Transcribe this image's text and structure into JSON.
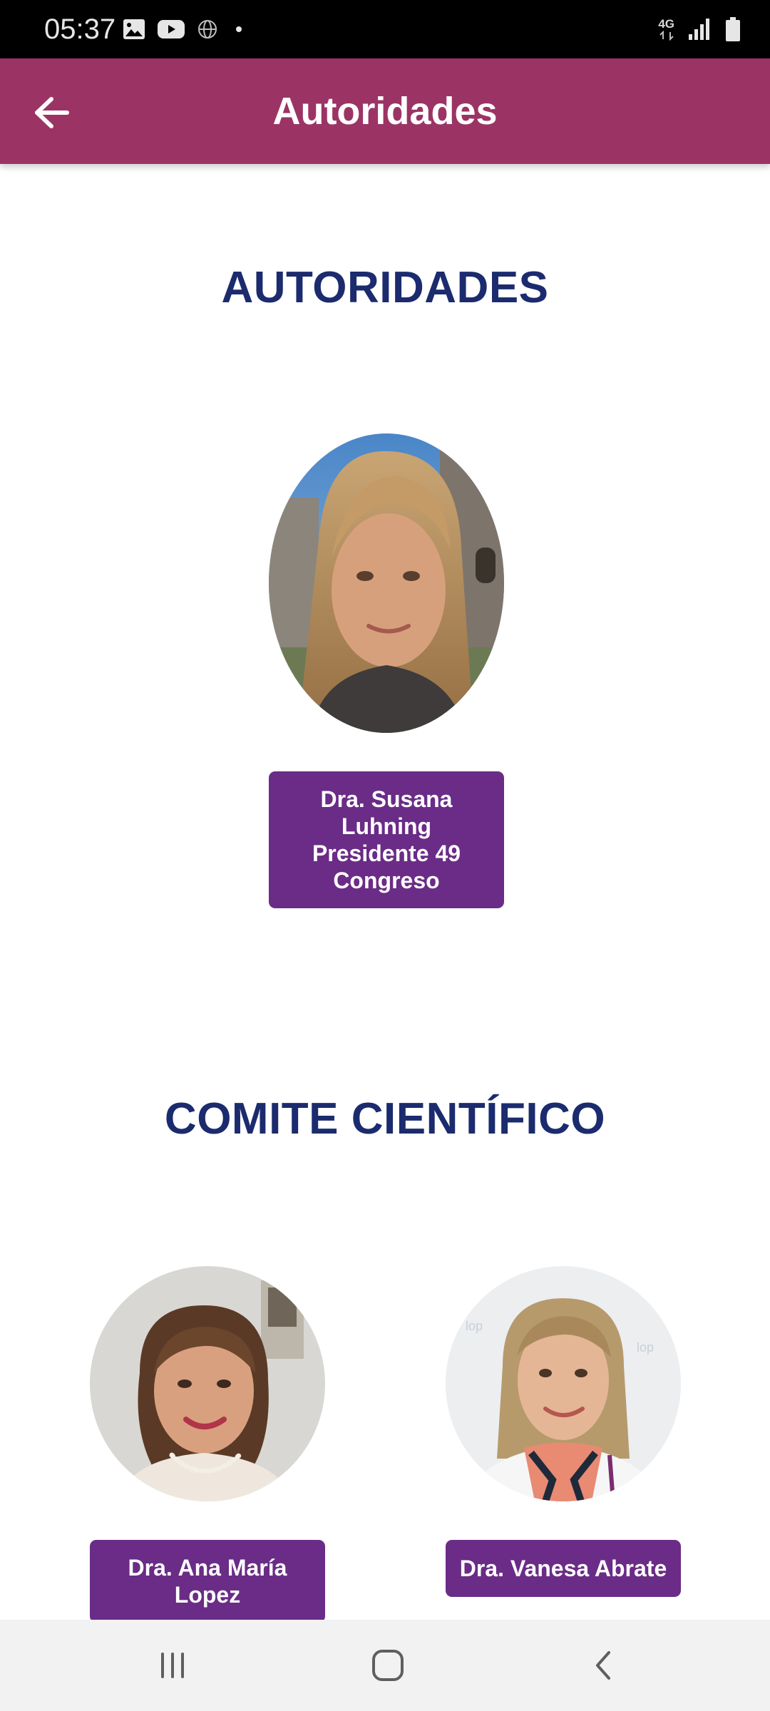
{
  "status_bar": {
    "time": "05:37",
    "left_icons": [
      "image-icon",
      "youtube-icon",
      "globe-icon",
      "dot-icon"
    ],
    "network_label": "4G",
    "right_icons": [
      "signal-icon",
      "battery-icon"
    ]
  },
  "app_bar": {
    "title": "Autoridades",
    "back_icon": "arrow-left-icon"
  },
  "sections": {
    "authorities": {
      "heading": "AUTORIDADES",
      "people": [
        {
          "name_lines": [
            "Dra. Susana",
            "Luhning",
            "Presidente 49",
            "Congreso"
          ]
        }
      ]
    },
    "scientific_committee": {
      "heading": "COMITE CIENTÍFICO",
      "people": [
        {
          "name_lines": [
            "Dra. Ana María",
            "Lopez"
          ]
        },
        {
          "name_lines": [
            "Dra. Vanesa Abrate"
          ]
        }
      ]
    }
  },
  "nav_bar": {
    "icons": [
      "recent-apps-icon",
      "home-icon",
      "back-icon"
    ]
  },
  "colors": {
    "app_bar": "#9b3465",
    "heading": "#1b2b6e",
    "name_card": "#6a2c86",
    "nav_bar": "#f2f2f2"
  }
}
